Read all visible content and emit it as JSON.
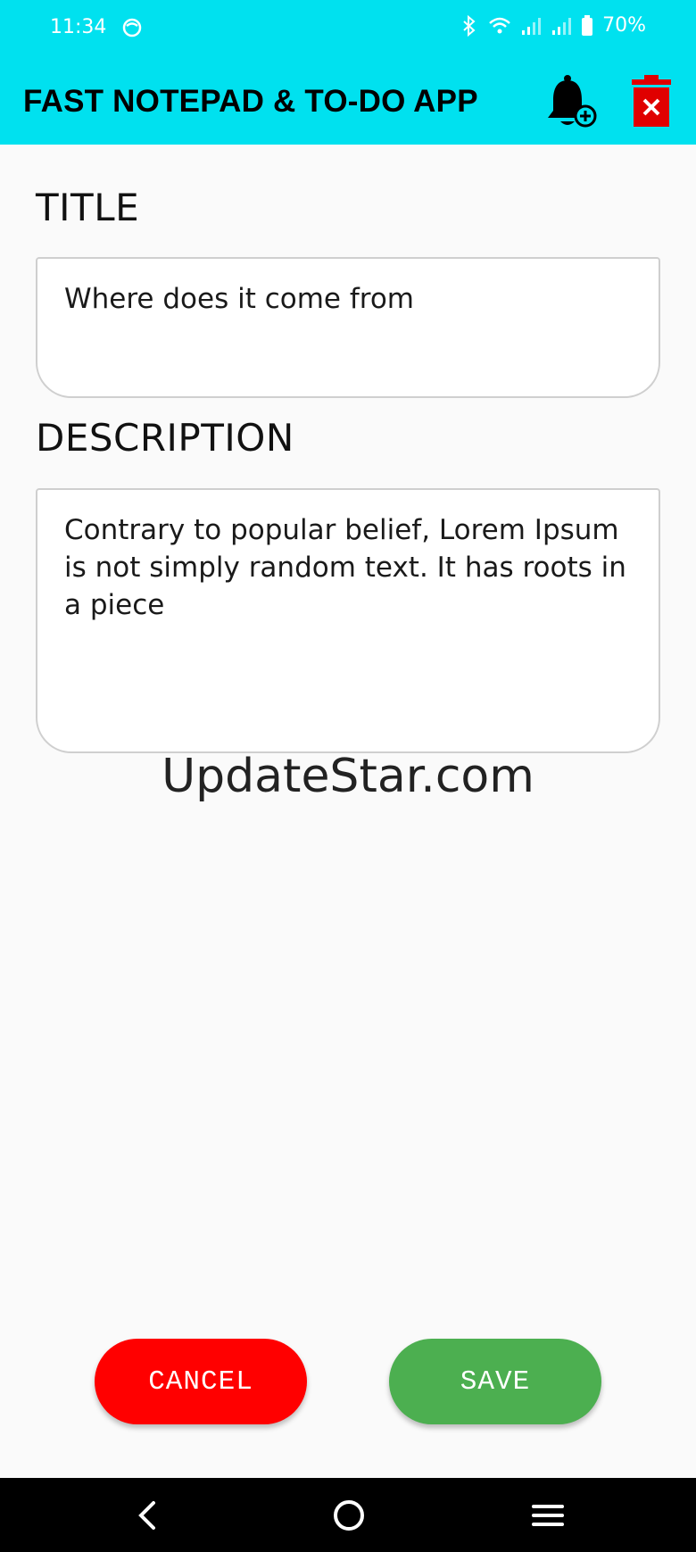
{
  "status_bar": {
    "time": "11:34",
    "battery": "70%",
    "app_icon": "notification-app-icon",
    "icons": [
      "bluetooth-icon",
      "wifi-icon",
      "signal-icon",
      "signal-icon",
      "battery-icon"
    ]
  },
  "app_bar": {
    "title": "FAST NOTEPAD & TO-DO APP",
    "background": "#00e1ef",
    "actions": [
      "add-reminder-bell-icon",
      "delete-trash-icon"
    ]
  },
  "form": {
    "title_label": "TITLE",
    "title_value": "Where does it come from",
    "description_label": "DESCRIPTION",
    "description_value": "Contrary to popular belief, Lorem Ipsum is not simply random text. It has roots in a piece"
  },
  "watermark": "UpdateStar.com",
  "buttons": {
    "cancel_label": "CANCEL",
    "save_label": "SAVE",
    "cancel_color": "#ff0000",
    "save_color": "#4caf50"
  },
  "nav_bar": {
    "icons": [
      "back-icon",
      "home-icon",
      "recent-apps-icon"
    ]
  }
}
